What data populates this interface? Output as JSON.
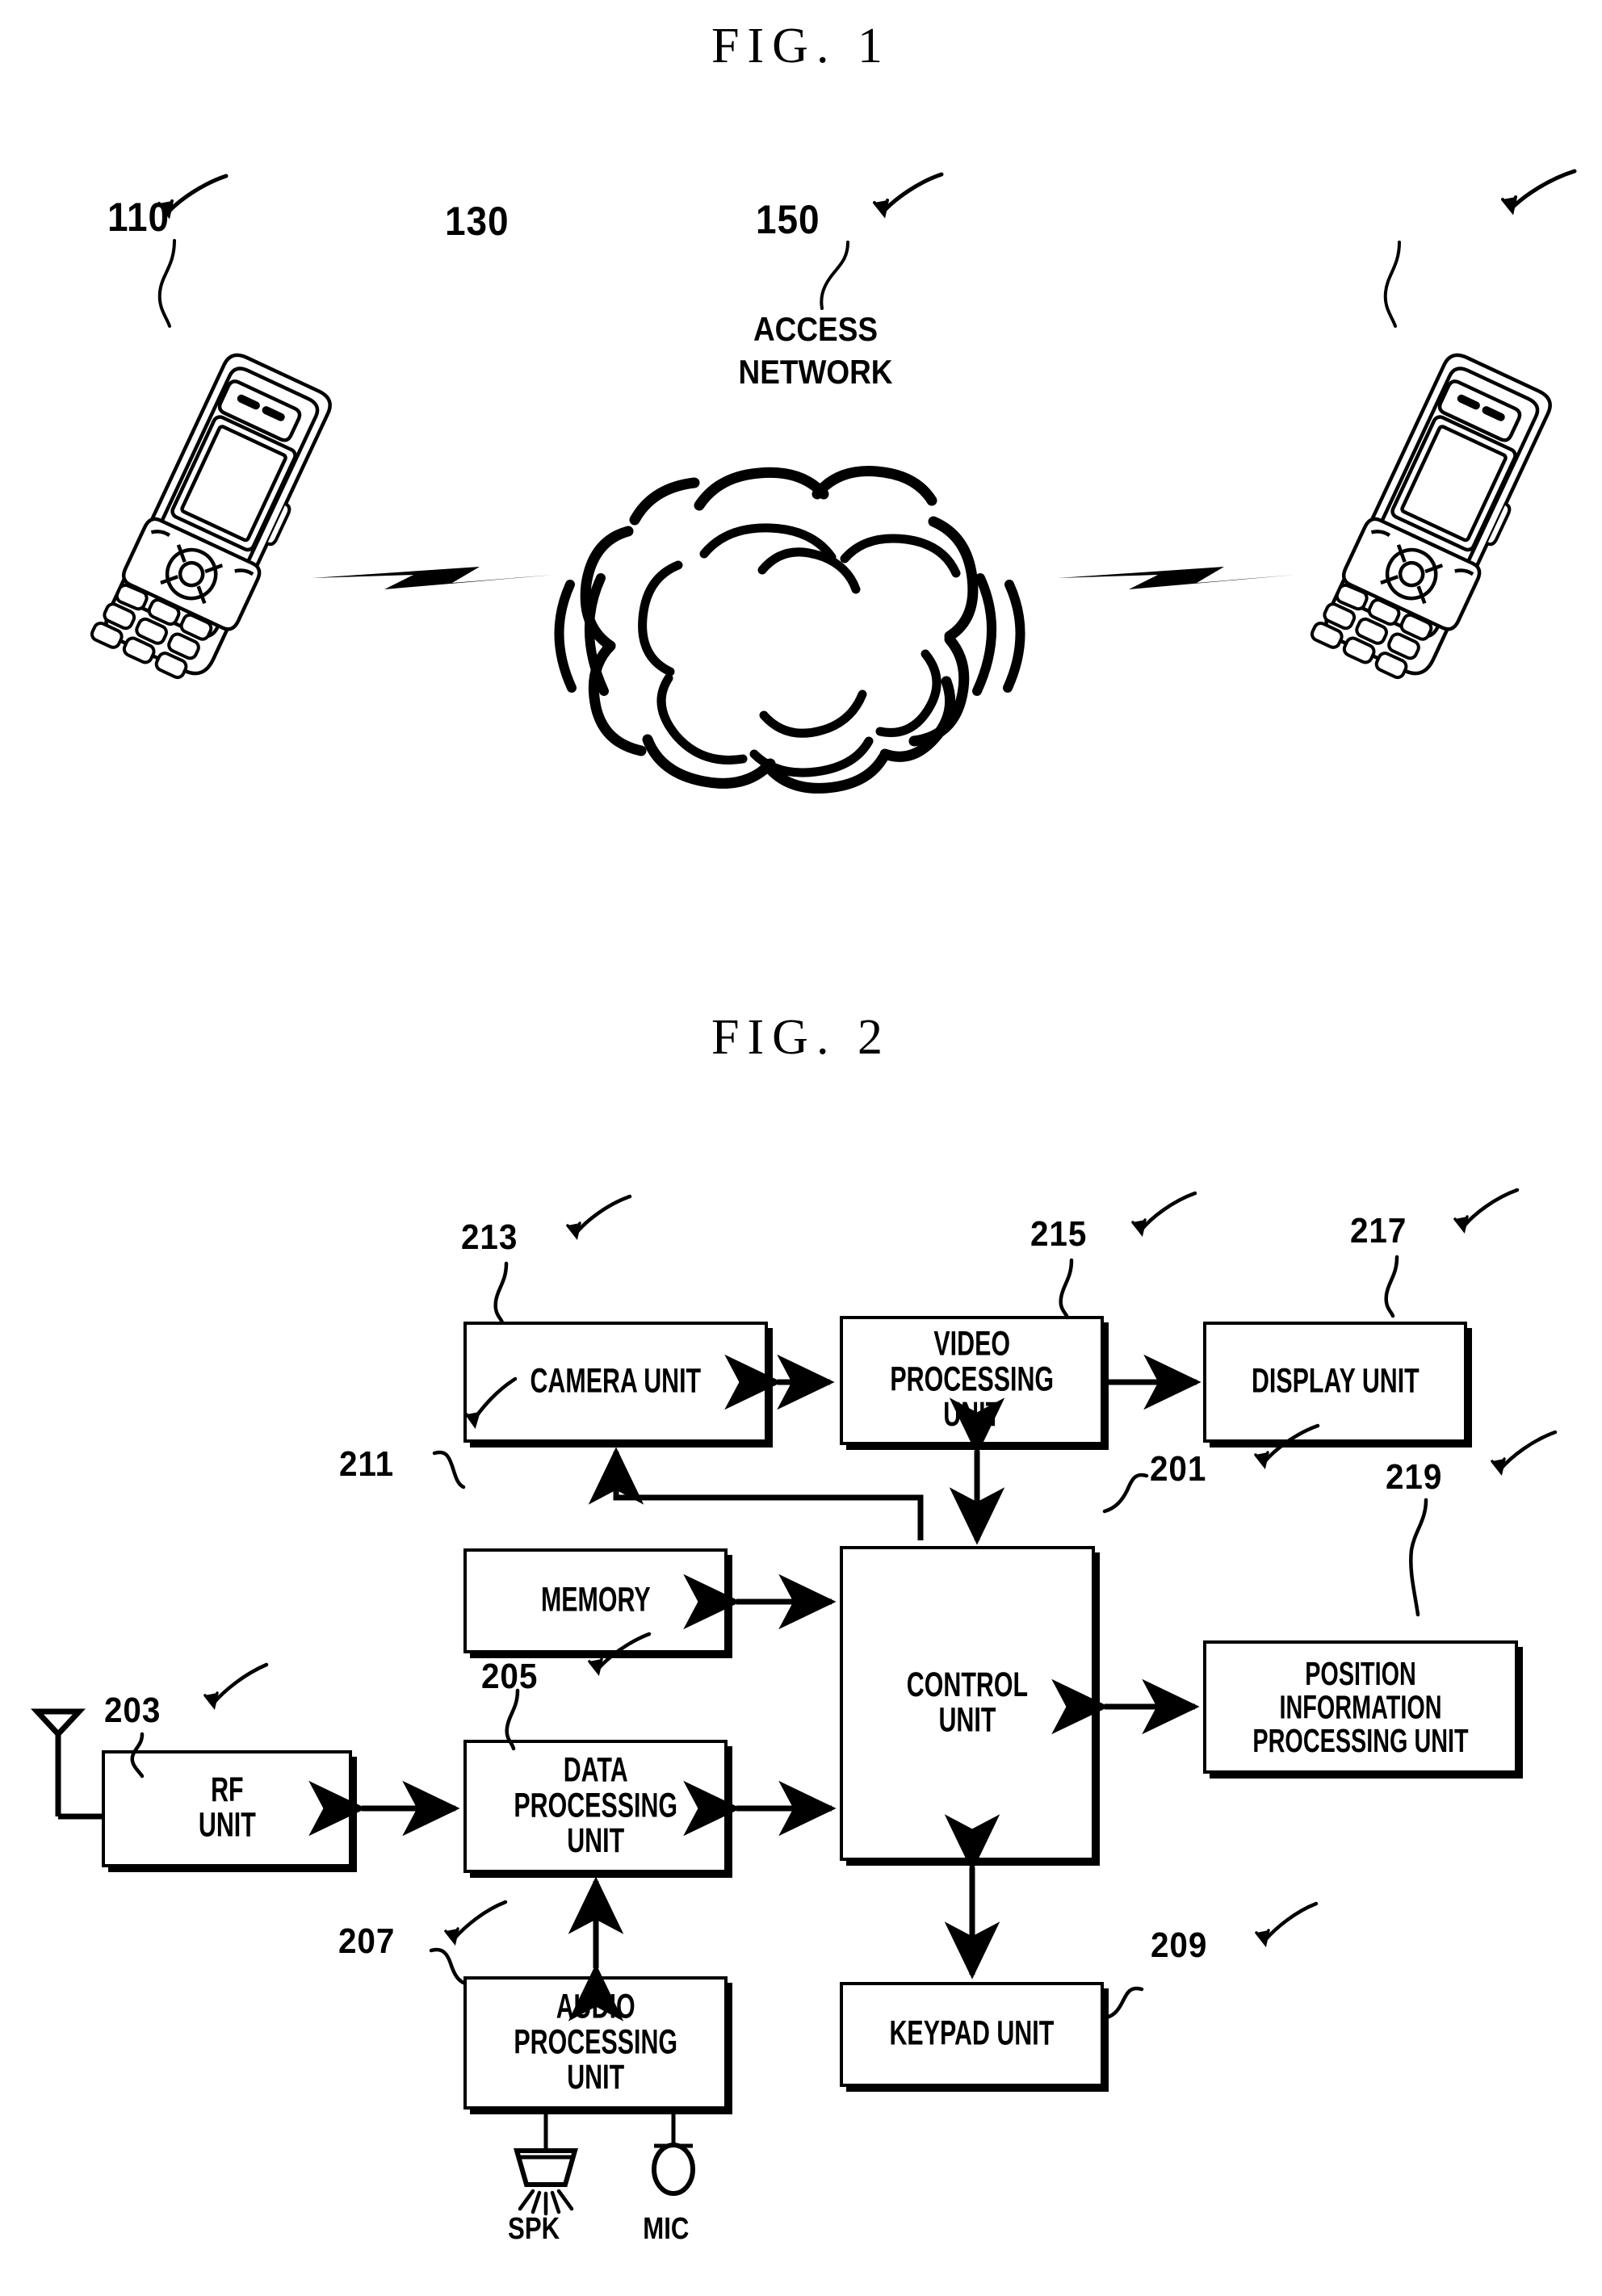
{
  "figures": {
    "fig1": {
      "title": "FIG. 1",
      "nodes": {
        "left_terminal_ref": "110",
        "network_ref": "130",
        "right_terminal_ref": "150",
        "network_label": "ACCESS\nNETWORK"
      }
    },
    "fig2": {
      "title": "FIG. 2",
      "blocks": [
        {
          "ref": "213",
          "label": "CAMERA UNIT"
        },
        {
          "ref": "215",
          "label": "VIDEO\nPROCESSING\nUNIT"
        },
        {
          "ref": "217",
          "label": "DISPLAY UNIT"
        },
        {
          "ref": "211",
          "label": "MEMORY"
        },
        {
          "ref": "201",
          "label": "CONTROL\nUNIT"
        },
        {
          "ref": "219",
          "label": "POSITION\nINFORMATION\nPROCESSING UNIT"
        },
        {
          "ref": "203",
          "label": "RF\nUNIT"
        },
        {
          "ref": "205",
          "label": "DATA\nPROCESSING\nUNIT"
        },
        {
          "ref": "207",
          "label": "AUDIO\nPROCESSING\nUNIT"
        },
        {
          "ref": "209",
          "label": "KEYPAD UNIT"
        }
      ],
      "transducers": {
        "speaker_label": "SPK",
        "mic_label": "MIC"
      }
    }
  },
  "colors": {
    "ink": "#000000",
    "paper": "#ffffff"
  }
}
